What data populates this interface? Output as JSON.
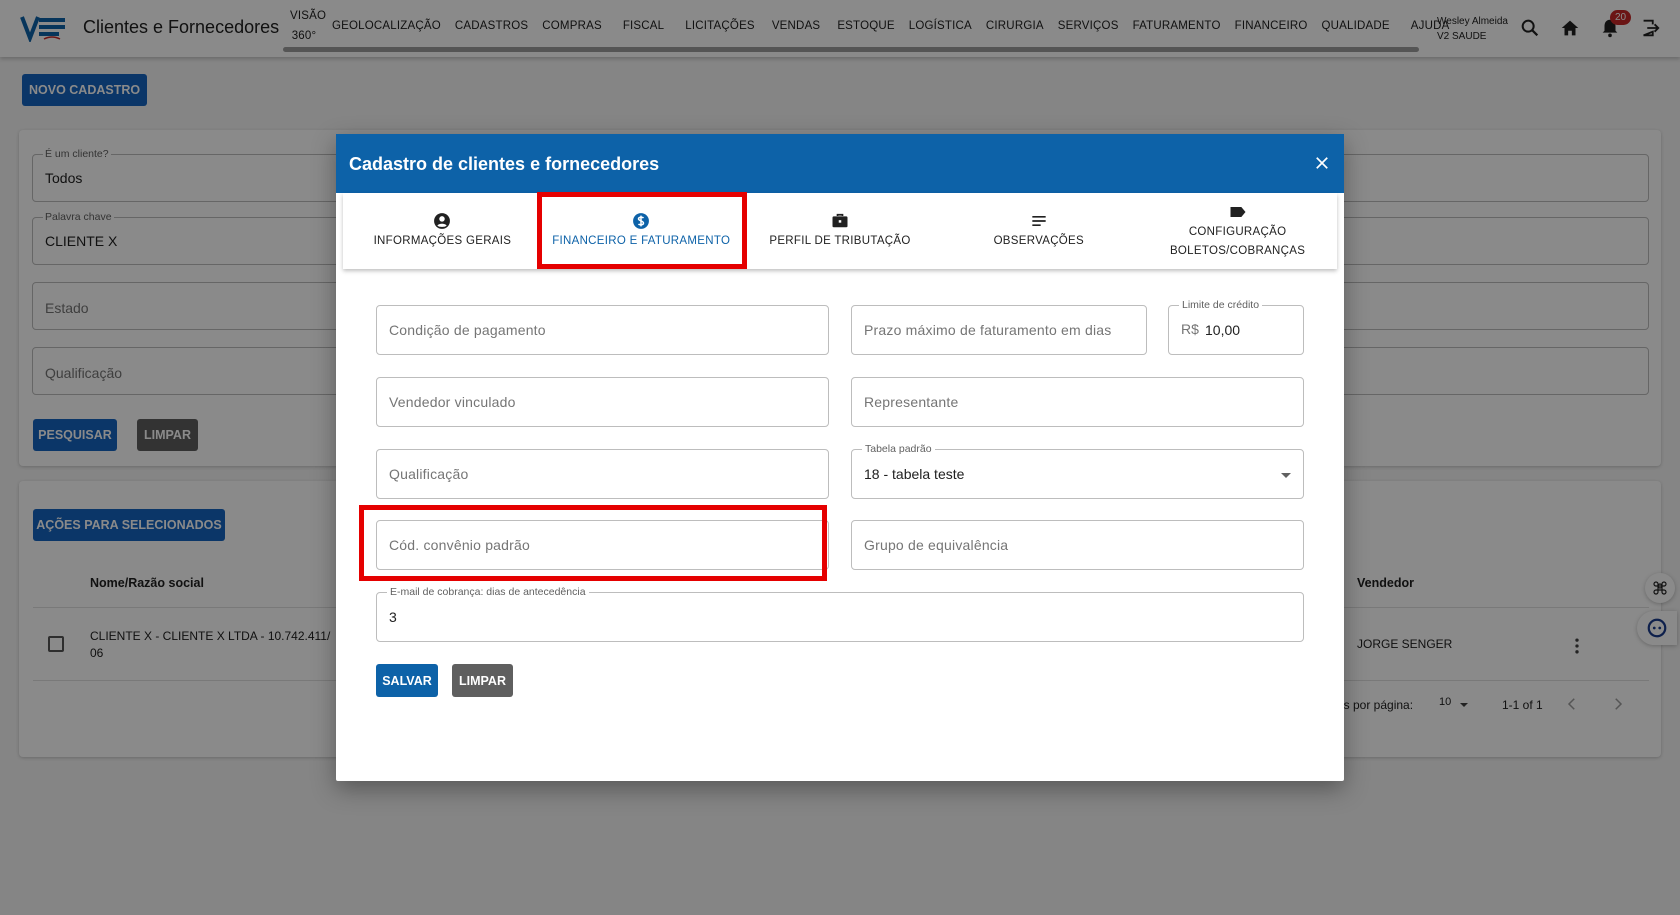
{
  "app": {
    "title": "Clientes e Fornecedores",
    "logo_text": "V2 Saude"
  },
  "nav": {
    "items": [
      {
        "label": "VISÃO 360°"
      },
      {
        "label": "GEOLOCALIZAÇÃO"
      },
      {
        "label": "CADASTROS"
      },
      {
        "label": "COMPRAS"
      },
      {
        "label": "FISCAL"
      },
      {
        "label": "LICITAÇÕES"
      },
      {
        "label": "VENDAS"
      },
      {
        "label": "ESTOQUE"
      },
      {
        "label": "LOGÍSTICA"
      },
      {
        "label": "CIRURGIA"
      },
      {
        "label": "SERVIÇOS"
      },
      {
        "label": "FATURAMENTO"
      },
      {
        "label": "FINANCEIRO"
      },
      {
        "label": "QUALIDADE"
      },
      {
        "label": "AJUDA"
      }
    ]
  },
  "user": {
    "name": "Wesley Almeida",
    "company": "V2 SAUDE",
    "notifications": "20"
  },
  "page": {
    "new_button": "NOVO CADASTRO",
    "filters": {
      "cliente_label": "É um cliente?",
      "cliente_value": "Todos",
      "keyword_label": "Palavra chave",
      "keyword_value": "CLIENTE X",
      "estado_placeholder": "Estado",
      "qualificacao_placeholder": "Qualificação",
      "search_button": "PESQUISAR",
      "clear_button": "LIMPAR"
    },
    "table": {
      "bulk_button": "AÇÕES PARA SELECIONADOS",
      "col_name": "Nome/Razão social",
      "col_seller": "Vendedor",
      "rows": [
        {
          "name_line1": "CLIENTE X - CLIENTE X LTDA - 10.742.411/",
          "name_line2": "06",
          "seller": "JORGE SENGER"
        }
      ],
      "rows_per_page_label": "as por página:",
      "rows_per_page": "10",
      "range": "1-1 of 1"
    }
  },
  "modal": {
    "title": "Cadastro de clientes e fornecedores",
    "tabs": [
      {
        "label": "INFORMAÇÕES GERAIS",
        "icon": "account-circle-icon"
      },
      {
        "label": "FINANCEIRO E FATURAMENTO",
        "icon": "dollar-circle-icon",
        "active": true
      },
      {
        "label": "PERFIL DE TRIBUTAÇÃO",
        "icon": "briefcase-icon"
      },
      {
        "label": "OBSERVAÇÕES",
        "icon": "notes-icon"
      },
      {
        "label_line1": "CONFIGURAÇÃO",
        "label_line2": "BOLETOS/COBRANÇAS",
        "icon": "label-tag-icon"
      }
    ],
    "fields": {
      "condicao_pagamento": "Condição de pagamento",
      "prazo_maximo": "Prazo máximo de faturamento em dias",
      "limite_credito_label": "Limite de crédito",
      "limite_credito_prefix": "R$",
      "limite_credito_value": "10,00",
      "vendedor_vinculado": "Vendedor vinculado",
      "representante": "Representante",
      "qualificacao": "Qualificação",
      "tabela_padrao_label": "Tabela padrão",
      "tabela_padrao_value": "18 - tabela teste",
      "cod_convenio": "Cód. convênio padrão",
      "grupo_equivalencia": "Grupo de equivalência",
      "email_cobranca_label": "E-mail de cobrança: dias de antecedência",
      "email_cobranca_value": "3"
    },
    "save_button": "SALVAR",
    "clear_button": "LIMPAR"
  },
  "colors": {
    "primary": "#0d62a8",
    "highlight": "#e50000",
    "button_grey": "#5f5f5f"
  }
}
